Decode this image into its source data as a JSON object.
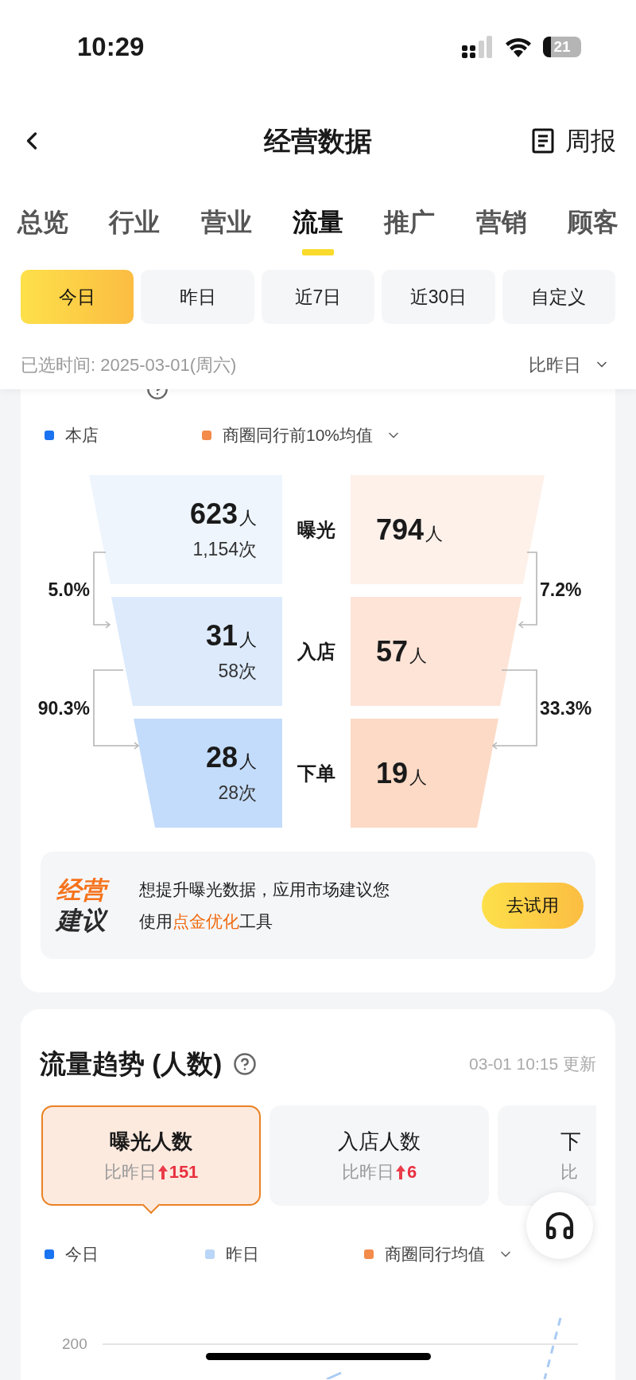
{
  "status_bar": {
    "time": "10:29",
    "battery": "21"
  },
  "nav": {
    "title": "经营数据",
    "action": "周报"
  },
  "tabs": [
    {
      "label": "总览",
      "selected": false
    },
    {
      "label": "行业",
      "selected": false
    },
    {
      "label": "营业",
      "selected": false
    },
    {
      "label": "流量",
      "selected": true
    },
    {
      "label": "推广",
      "selected": false
    },
    {
      "label": "营销",
      "selected": false
    },
    {
      "label": "顾客",
      "selected": false
    }
  ],
  "date_ranges": [
    {
      "label": "今日",
      "selected": true
    },
    {
      "label": "昨日",
      "selected": false
    },
    {
      "label": "近7日",
      "selected": false
    },
    {
      "label": "近30日",
      "selected": false
    },
    {
      "label": "自定义",
      "selected": false
    }
  ],
  "selected_time": "已选时间: 2025-03-01(周六)",
  "compare_mode": "比昨日",
  "conversion": {
    "legend": [
      {
        "label": "本店",
        "color": "#1a73f0",
        "dropdown": false
      },
      {
        "label": "商圈同行前10%均值",
        "color": "#f38b4a",
        "dropdown": true
      }
    ],
    "stages": [
      {
        "label": "曝光",
        "store": {
          "people": "623",
          "unit": "人",
          "times": "1,154次"
        },
        "peer": {
          "people": "794",
          "unit": "人"
        }
      },
      {
        "label": "入店",
        "store": {
          "people": "31",
          "unit": "人",
          "times": "58次"
        },
        "peer": {
          "people": "57",
          "unit": "人"
        }
      },
      {
        "label": "下单",
        "store": {
          "people": "28",
          "unit": "人",
          "times": "28次"
        },
        "peer": {
          "people": "19",
          "unit": "人"
        }
      }
    ],
    "store_rates": [
      "5.0%",
      "90.3%"
    ],
    "peer_rates": [
      "7.2%",
      "33.3%"
    ],
    "suggestion": {
      "badge_top": "经营",
      "badge_bottom": "建议",
      "text": "想提升曝光数据，应用市场建议您使用**点金优化**工具",
      "button": "去试用"
    }
  },
  "trend": {
    "title": "流量趋势 (人数)",
    "updated": "03-01 10:15 更新",
    "metrics": [
      {
        "kind": "full",
        "name": "曝光人数",
        "compare": "比昨日",
        "delta": "151",
        "selected": true
      },
      {
        "kind": "full",
        "name": "入店人数",
        "compare": "比昨日",
        "delta": "6",
        "selected": false
      },
      {
        "kind": "cut",
        "name": "下",
        "compare": "比",
        "selected": false
      }
    ],
    "legend": [
      {
        "label": "今日",
        "color": "#1a73f0",
        "dropdown": false
      },
      {
        "label": "昨日",
        "color": "#b9d6f8",
        "dropdown": false
      },
      {
        "label": "商圈同行均值",
        "color": "#f38b4a",
        "dropdown": true
      }
    ],
    "chart": {
      "y_tick": "200"
    }
  }
}
